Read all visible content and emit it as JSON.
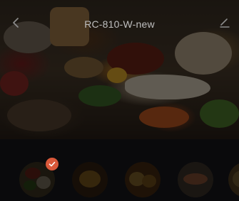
{
  "header": {
    "title": "RC-810-W-new",
    "back_icon": "chevron-left-icon",
    "edit_icon": "edit-icon"
  },
  "hero": {
    "image": "food-spread-photo"
  },
  "recipes": {
    "items": [
      {
        "name": "recipe-thumb-1",
        "selected": true
      },
      {
        "name": "recipe-thumb-2",
        "selected": false
      },
      {
        "name": "recipe-thumb-3",
        "selected": false
      },
      {
        "name": "recipe-thumb-4",
        "selected": false
      },
      {
        "name": "recipe-thumb-5",
        "selected": false
      }
    ],
    "check_icon": "checkmark-icon",
    "accent": "#d9583a"
  },
  "colors": {
    "background": "#0b0b0d",
    "panel": "#17181b",
    "title": "#bfbfbf"
  }
}
